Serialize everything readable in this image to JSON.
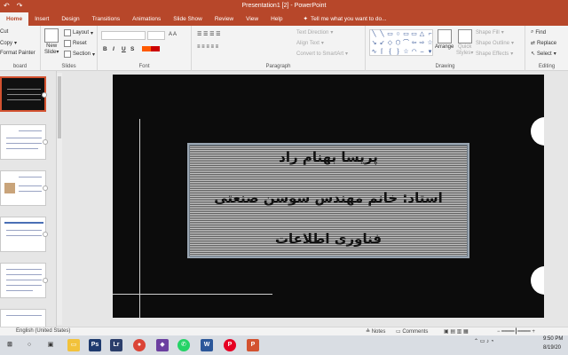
{
  "titlebar": {
    "title": "Presentation1 [2] - PowerPoint",
    "undo": "↶",
    "redo": "↷"
  },
  "tabs": [
    "Home",
    "Insert",
    "Design",
    "Transitions",
    "Animations",
    "Slide Show",
    "Review",
    "View",
    "Help"
  ],
  "tellme": "Tell me what you want to do...",
  "ribbon": {
    "clipboard": {
      "cut": "Cut",
      "copy": "Copy",
      "format_painter": "Format Painter",
      "label": "board"
    },
    "slides": {
      "new_slide": "New",
      "new_slide2": "Slide",
      "layout": "Layout",
      "reset": "Reset",
      "section": "Section",
      "label": "Slides"
    },
    "font": {
      "bold": "B",
      "italic": "I",
      "underline": "U",
      "strike": "S",
      "label": "Font"
    },
    "paragraph": {
      "text_direction": "Text Direction",
      "align_text": "Align Text",
      "convert_smartart": "Convert to SmartArt",
      "label": "Paragraph"
    },
    "drawing": {
      "arrange": "Arrange",
      "quick_styles": "Quick",
      "quick_styles2": "Styles",
      "shape_fill": "Shape Fill",
      "shape_outline": "Shape Outline",
      "shape_effects": "Shape Effects",
      "label": "Drawing"
    },
    "editing": {
      "find": "Find",
      "replace": "Replace",
      "select": "Select",
      "label": "Editing"
    }
  },
  "slide": {
    "line1": "پریسا بهنام راد",
    "line2": "استاد: خانم  مهندس سوسن صنعتی",
    "line3": "فناوری اطلاعات"
  },
  "statusbar": {
    "language": "English (United States)",
    "notes": "Notes",
    "comments": "Comments"
  },
  "taskbar": {
    "time": "9:50 PM",
    "date": "8/19/20"
  },
  "colors": {
    "accent": "#b7472a",
    "slide_bg": "#0c0c0c"
  }
}
